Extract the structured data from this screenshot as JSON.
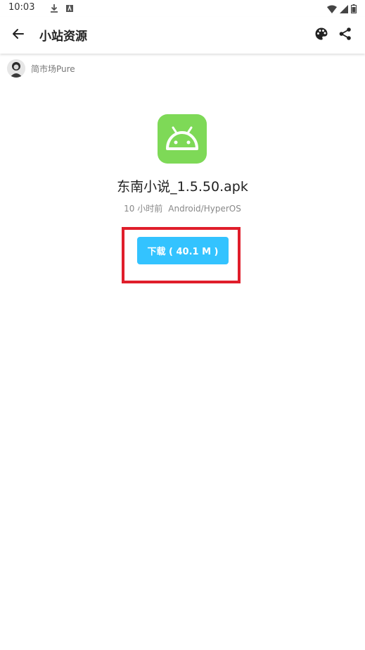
{
  "status_bar": {
    "time": "10:03",
    "icons": [
      "download-icon",
      "a-icon",
      "wifi-icon",
      "signal-icon",
      "battery-icon"
    ]
  },
  "app_bar": {
    "title": "小站资源",
    "icons": [
      "back-arrow-icon",
      "palette-icon",
      "share-icon"
    ]
  },
  "author": {
    "name": "简市场Pure",
    "icon": "avatar"
  },
  "file": {
    "icon": "android-icon",
    "icon_color": "#7ed957",
    "name": "东南小说_1.5.50.apk",
    "time": "10 小时前",
    "platform": "Android/HyperOS"
  },
  "download": {
    "label": "下载 ( 40.1 M )",
    "color": "#33c3ff"
  },
  "highlight": {
    "color": "#e01e2b"
  }
}
